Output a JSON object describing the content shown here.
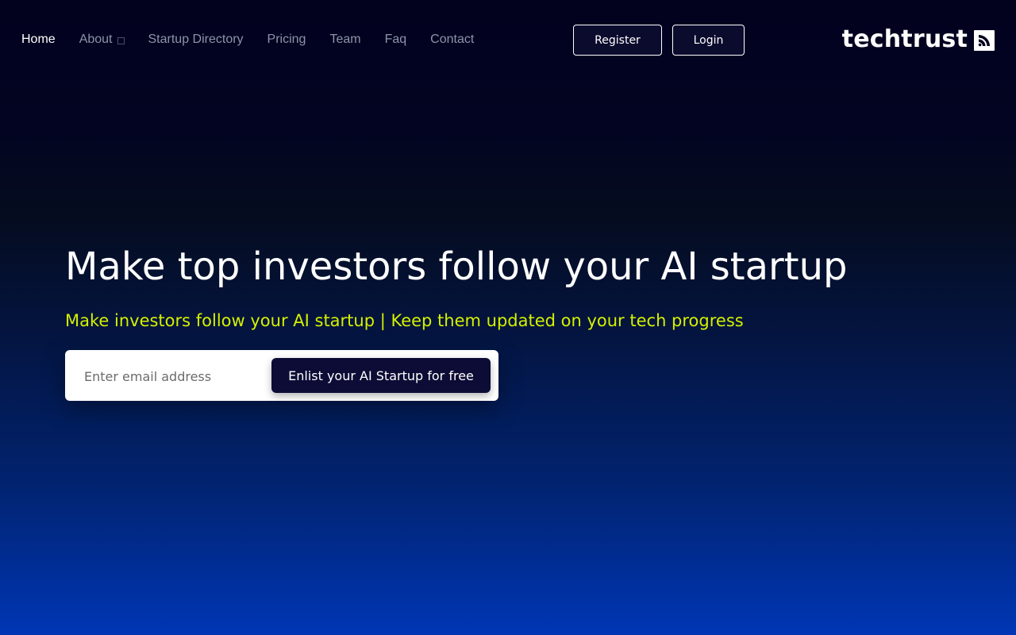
{
  "nav": {
    "items": [
      {
        "label": "Home",
        "active": true
      },
      {
        "label": "About",
        "has_dropdown": true
      },
      {
        "label": "Startup Directory"
      },
      {
        "label": "Pricing"
      },
      {
        "label": "Team"
      },
      {
        "label": "Faq"
      },
      {
        "label": "Contact"
      }
    ]
  },
  "auth": {
    "register_label": "Register",
    "login_label": "Login"
  },
  "logo": {
    "text": "techtrust",
    "icon": "rss-feed-icon"
  },
  "hero": {
    "title": "Make top investors follow your AI startup",
    "subtitle": "Make investors follow your AI startup | Keep them updated on your tech progress"
  },
  "signup": {
    "email_placeholder": "Enter email address",
    "email_value": "",
    "cta_label": "Enlist your AI Startup for free"
  },
  "colors": {
    "subtitle_accent": "#d4f000",
    "button_dark": "#0c0c36",
    "background_top": "#02021f",
    "background_bottom": "#0036b5"
  }
}
